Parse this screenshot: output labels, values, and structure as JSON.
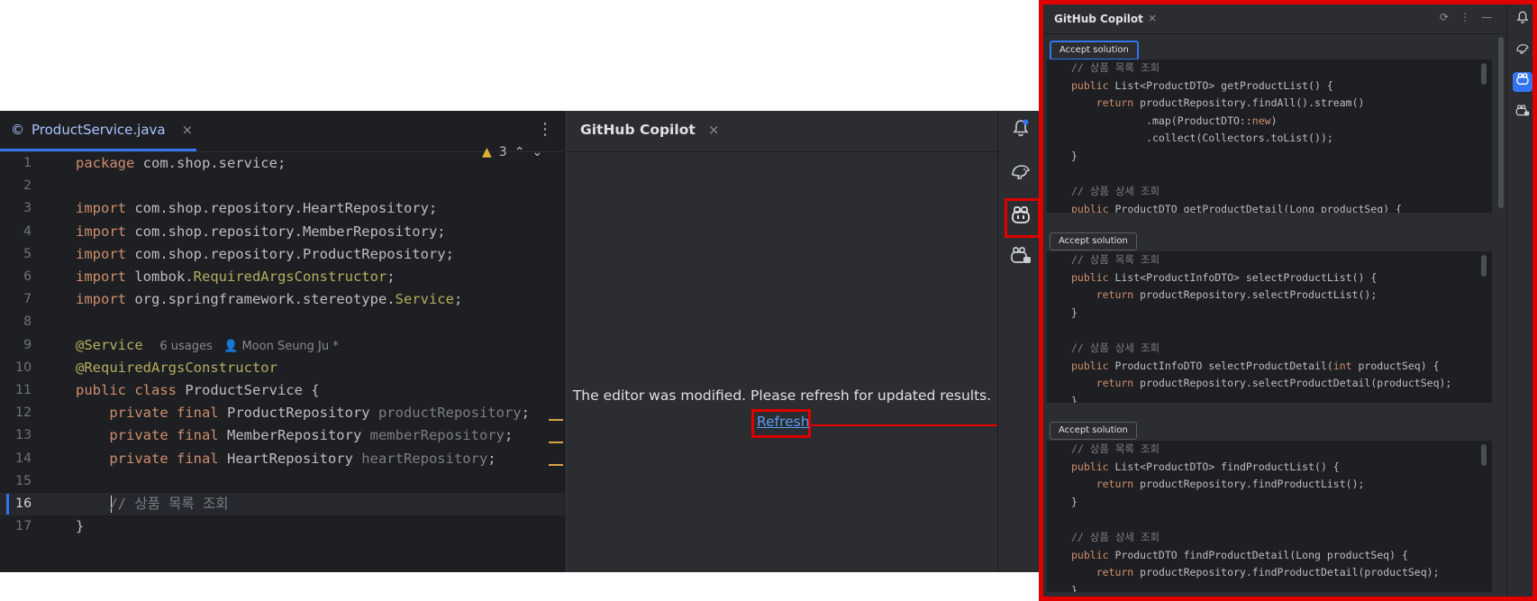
{
  "editor": {
    "tab_icon": "©",
    "tab_label": "ProductService.java",
    "tab_close": "×",
    "more": "⋮",
    "warning_count": "3",
    "lines": [
      {
        "n": "1",
        "tokens": [
          {
            "t": "package ",
            "c": "kw"
          },
          {
            "t": "com.shop.service;",
            "c": "cls"
          }
        ]
      },
      {
        "n": "2",
        "tokens": []
      },
      {
        "n": "3",
        "tokens": [
          {
            "t": "import ",
            "c": "kw"
          },
          {
            "t": "com.shop.repository.HeartRepository;",
            "c": "cls"
          }
        ]
      },
      {
        "n": "4",
        "tokens": [
          {
            "t": "import ",
            "c": "kw"
          },
          {
            "t": "com.shop.repository.MemberRepository;",
            "c": "cls"
          }
        ]
      },
      {
        "n": "5",
        "tokens": [
          {
            "t": "import ",
            "c": "kw"
          },
          {
            "t": "com.shop.repository.ProductRepository;",
            "c": "cls"
          }
        ]
      },
      {
        "n": "6",
        "tokens": [
          {
            "t": "import ",
            "c": "kw"
          },
          {
            "t": "lombok.",
            "c": "cls"
          },
          {
            "t": "RequiredArgsConstructor",
            "c": "ann"
          },
          {
            "t": ";",
            "c": "cls"
          }
        ]
      },
      {
        "n": "7",
        "tokens": [
          {
            "t": "import ",
            "c": "kw"
          },
          {
            "t": "org.springframework.stereotype.",
            "c": "cls"
          },
          {
            "t": "Service",
            "c": "ann"
          },
          {
            "t": ";",
            "c": "cls"
          }
        ]
      },
      {
        "n": "8",
        "tokens": []
      },
      {
        "n": "9",
        "tokens": [
          {
            "t": "@Service",
            "c": "ann"
          },
          {
            "t": "  ",
            "c": "cls"
          },
          {
            "t": "6 usages   👤 Moon Seung Ju *",
            "c": "hint"
          }
        ]
      },
      {
        "n": "10",
        "tokens": [
          {
            "t": "@RequiredArgsConstructor",
            "c": "ann"
          }
        ]
      },
      {
        "n": "11",
        "tokens": [
          {
            "t": "public class ",
            "c": "kw"
          },
          {
            "t": "ProductService {",
            "c": "cls"
          }
        ]
      },
      {
        "n": "12",
        "tokens": [
          {
            "t": "    private final ",
            "c": "kw"
          },
          {
            "t": "ProductRepository ",
            "c": "cls"
          },
          {
            "t": "productRepository",
            "c": "fld"
          },
          {
            "t": ";",
            "c": "cls"
          }
        ]
      },
      {
        "n": "13",
        "tokens": [
          {
            "t": "    private final ",
            "c": "kw"
          },
          {
            "t": "MemberRepository ",
            "c": "cls"
          },
          {
            "t": "memberRepository",
            "c": "fld"
          },
          {
            "t": ";",
            "c": "cls"
          }
        ]
      },
      {
        "n": "14",
        "tokens": [
          {
            "t": "    private final ",
            "c": "kw"
          },
          {
            "t": "HeartRepository ",
            "c": "cls"
          },
          {
            "t": "heartRepository",
            "c": "fld"
          },
          {
            "t": ";",
            "c": "cls"
          }
        ]
      },
      {
        "n": "15",
        "tokens": []
      },
      {
        "n": "16",
        "tokens": [
          {
            "t": "    // 상품 목록 조회",
            "c": "cmt"
          }
        ]
      },
      {
        "n": "17",
        "tokens": [
          {
            "t": "}",
            "c": "cls"
          }
        ]
      }
    ]
  },
  "copilot_panel": {
    "title": "GitHub Copilot",
    "close": "×",
    "message": "The editor was modified. Please refresh for updated results.",
    "refresh_label": "Refresh"
  },
  "right_strip": {
    "icons": [
      "bell-icon",
      "elephant-icon",
      "copilot-icon",
      "copilot-chat-icon"
    ]
  },
  "popup": {
    "title": "GitHub Copilot",
    "close": "×",
    "actions": [
      "⟳",
      "⋮",
      "—"
    ],
    "solutions": [
      {
        "accept_label": "Accept solution",
        "lines": [
          [
            {
              "t": "// 상품 목록 조회",
              "c": "cmt"
            }
          ],
          [
            {
              "t": "public ",
              "c": "kw"
            },
            {
              "t": "List<ProductDTO> getProductList() {",
              "c": "cls"
            }
          ],
          [
            {
              "t": "    return ",
              "c": "kw"
            },
            {
              "t": "productRepository.findAll().stream()",
              "c": "cls"
            }
          ],
          [
            {
              "t": "            .map(ProductDTO::",
              "c": "cls"
            },
            {
              "t": "new",
              "c": "kw"
            },
            {
              "t": ")",
              "c": "cls"
            }
          ],
          [
            {
              "t": "            .collect(Collectors.toList());",
              "c": "cls"
            }
          ],
          [
            {
              "t": "}",
              "c": "cls"
            }
          ],
          [],
          [
            {
              "t": "// 상품 상세 조회",
              "c": "cmt"
            }
          ],
          [
            {
              "t": "public ",
              "c": "kw"
            },
            {
              "t": "ProductDTO getProductDetail(Long productSeq) {",
              "c": "cls"
            }
          ]
        ]
      },
      {
        "accept_label": "Accept solution",
        "lines": [
          [
            {
              "t": "// 상품 목록 조회",
              "c": "cmt"
            }
          ],
          [
            {
              "t": "public ",
              "c": "kw"
            },
            {
              "t": "List<ProductInfoDTO> selectProductList() {",
              "c": "cls"
            }
          ],
          [
            {
              "t": "    return ",
              "c": "kw"
            },
            {
              "t": "productRepository.selectProductList();",
              "c": "cls"
            }
          ],
          [
            {
              "t": "}",
              "c": "cls"
            }
          ],
          [],
          [
            {
              "t": "// 상품 상세 조회",
              "c": "cmt"
            }
          ],
          [
            {
              "t": "public ",
              "c": "kw"
            },
            {
              "t": "ProductInfoDTO selectProductDetail(",
              "c": "cls"
            },
            {
              "t": "int ",
              "c": "kw"
            },
            {
              "t": "productSeq) {",
              "c": "cls"
            }
          ],
          [
            {
              "t": "    return ",
              "c": "kw"
            },
            {
              "t": "productRepository.selectProductDetail(productSeq);",
              "c": "cls"
            }
          ],
          [
            {
              "t": "}",
              "c": "cls"
            }
          ]
        ]
      },
      {
        "accept_label": "Accept solution",
        "lines": [
          [
            {
              "t": "// 상품 목록 조회",
              "c": "cmt"
            }
          ],
          [
            {
              "t": "public ",
              "c": "kw"
            },
            {
              "t": "List<ProductDTO> findProductList() {",
              "c": "cls"
            }
          ],
          [
            {
              "t": "    return ",
              "c": "kw"
            },
            {
              "t": "productRepository.findProductList();",
              "c": "cls"
            }
          ],
          [
            {
              "t": "}",
              "c": "cls"
            }
          ],
          [],
          [
            {
              "t": "// 상품 상세 조회",
              "c": "cmt"
            }
          ],
          [
            {
              "t": "public ",
              "c": "kw"
            },
            {
              "t": "ProductDTO findProductDetail(Long productSeq) {",
              "c": "cls"
            }
          ],
          [
            {
              "t": "    return ",
              "c": "kw"
            },
            {
              "t": "productRepository.findProductDetail(productSeq);",
              "c": "cls"
            }
          ],
          [
            {
              "t": "}",
              "c": "cls"
            }
          ]
        ]
      }
    ],
    "strip_icons": [
      "bell-icon",
      "elephant-icon",
      "copilot-icon",
      "copilot-chat-icon"
    ]
  }
}
